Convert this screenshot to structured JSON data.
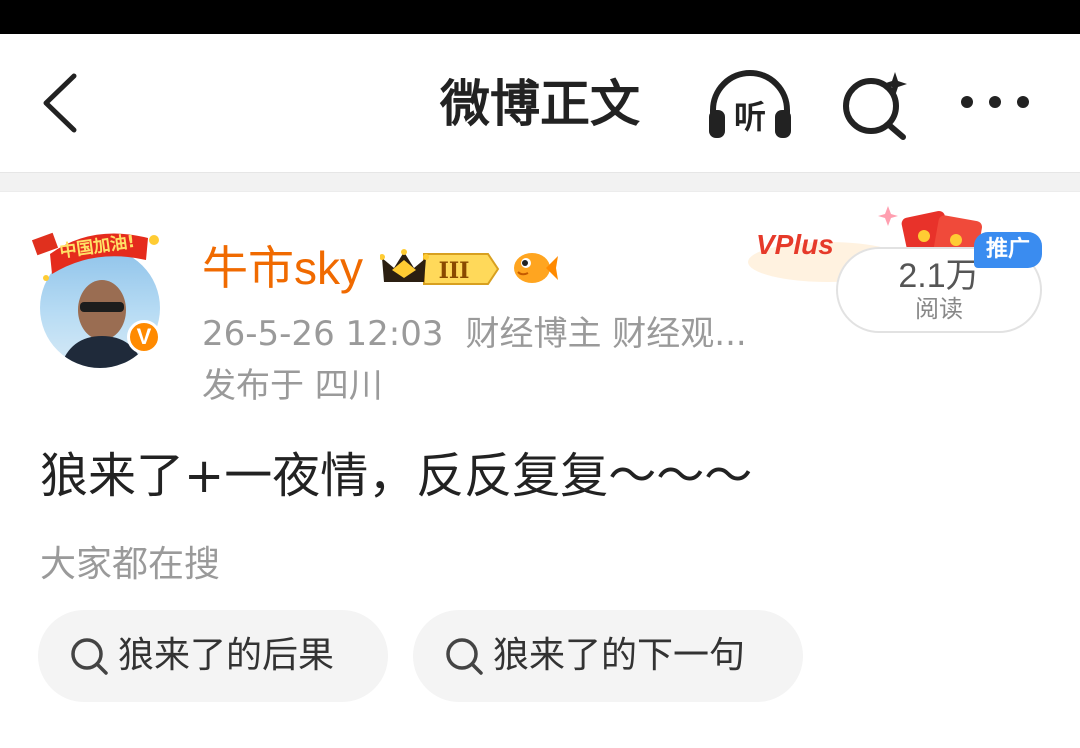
{
  "nav": {
    "title": "微博正文",
    "listen_label": "听"
  },
  "post": {
    "author": {
      "name": "牛市sky",
      "frame_text": "中国加油!",
      "verified_badge": "V",
      "level_badge": "III"
    },
    "time": "26-5-26 12:03",
    "role": "财经博主 财经观...",
    "location": "发布于 四川",
    "content": "狼来了+一夜情，反反复复～～～"
  },
  "promo": {
    "banner_text": "VPlus",
    "tag": "推广",
    "read_count": "2.1万",
    "read_label": "阅读"
  },
  "searches": {
    "heading": "大家都在搜",
    "items": [
      {
        "label": "狼来了的后果"
      },
      {
        "label": "狼来了的下一句"
      }
    ]
  },
  "colors": {
    "accent_orange": "#f06a00",
    "promo_blue": "#3a8cf0",
    "verified_orange": "#ff8a00"
  },
  "icons": [
    "chevron-left-icon",
    "headphones-icon",
    "search-sparkle-icon",
    "more-icon",
    "crown-icon",
    "fish-icon",
    "search-icon"
  ]
}
